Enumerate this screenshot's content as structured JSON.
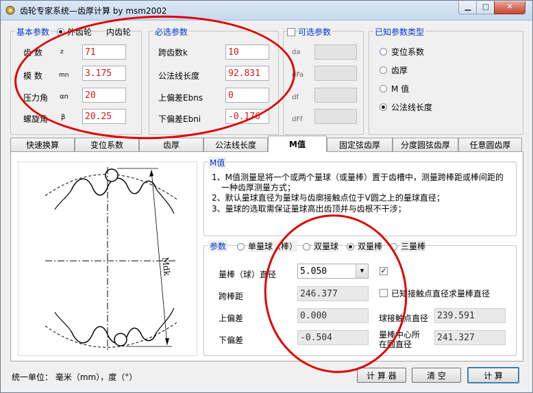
{
  "window": {
    "title": "齿轮专家系统—齿厚计算 by msm2002"
  },
  "basic": {
    "group_title": "基本参数",
    "gear_options": [
      "外齿轮",
      "内齿轮"
    ],
    "selected": "外齿轮",
    "fields": [
      {
        "label": "齿  数",
        "sub": "z",
        "value": "71"
      },
      {
        "label": "模  数",
        "sub": "mn",
        "value": "3.175"
      },
      {
        "label": "压力角",
        "sub": "αn",
        "value": "20"
      },
      {
        "label": "螺旋角",
        "sub": "β",
        "value": "20.25"
      }
    ]
  },
  "required": {
    "group_title": "必选参数",
    "fields": [
      {
        "label": "跨齿数k",
        "value": "10"
      },
      {
        "label": "公法线长度",
        "value": "92.831"
      },
      {
        "label": "上偏差Ebns",
        "value": "0"
      },
      {
        "label": "下偏差Ebni",
        "value": "-0.176"
      }
    ]
  },
  "optional": {
    "group_title": "可选参数",
    "checked": false,
    "fields": [
      {
        "label": "da",
        "value": ""
      },
      {
        "label": "dFa",
        "value": ""
      },
      {
        "label": "df",
        "value": ""
      },
      {
        "label": "dFf",
        "value": ""
      }
    ]
  },
  "known": {
    "group_title": "已知参数类型",
    "options": [
      "变位系数",
      "齿厚",
      "M 值",
      "公法线长度"
    ],
    "selected": "公法线长度"
  },
  "tabs": [
    "快速换算",
    "变位系数",
    "齿厚",
    "公法线长度",
    "M值",
    "固定弦齿厚",
    "分度圆弦齿厚",
    "任意圆齿厚"
  ],
  "active_tab": "M值",
  "m_group": {
    "title": "M值",
    "lines": [
      "1、M值测量是将一个或两个量球（或量棒）置于齿槽中，测量跨棒距或棒间距的",
      "一种齿厚测量方式；",
      "2、默认量球直径为量球与齿廓接触点位于V圆之上的量球直径；",
      "3、量球的选取需保证量球高出齿顶并与齿根不干涉；"
    ]
  },
  "params": {
    "title": "参数",
    "modes": [
      "单量球（棒）",
      "双量球",
      "双量棒",
      "三量棒"
    ],
    "selected_mode": "双量棒",
    "ball_label": "量棒（球）直径",
    "ball_value": "5.050",
    "ball_checked": true,
    "span_label": "跨棒距",
    "span_value": "246.377",
    "upper_label": "上偏差",
    "upper_value": "0.000",
    "lower_label": "下偏差",
    "lower_value": "-0.504",
    "known_contact_label": "已知接触点直径求量棒直径",
    "known_contact_checked": false,
    "contact_label": "球接触点直径",
    "contact_value": "239.591",
    "center_label_1": "量棒中心所",
    "center_label_2": "在圆直径",
    "center_value": "241.327"
  },
  "diagram": {
    "dim_label": "Mdk"
  },
  "footer": {
    "units": "统一单位：  毫米（mm），度（°）",
    "calc_tool": "计 算 器",
    "clear": "清  空",
    "compute": "计  算"
  },
  "colors": {
    "group_title": "#0033cc",
    "input_text": "#d01818",
    "annotation": "#e00000"
  }
}
